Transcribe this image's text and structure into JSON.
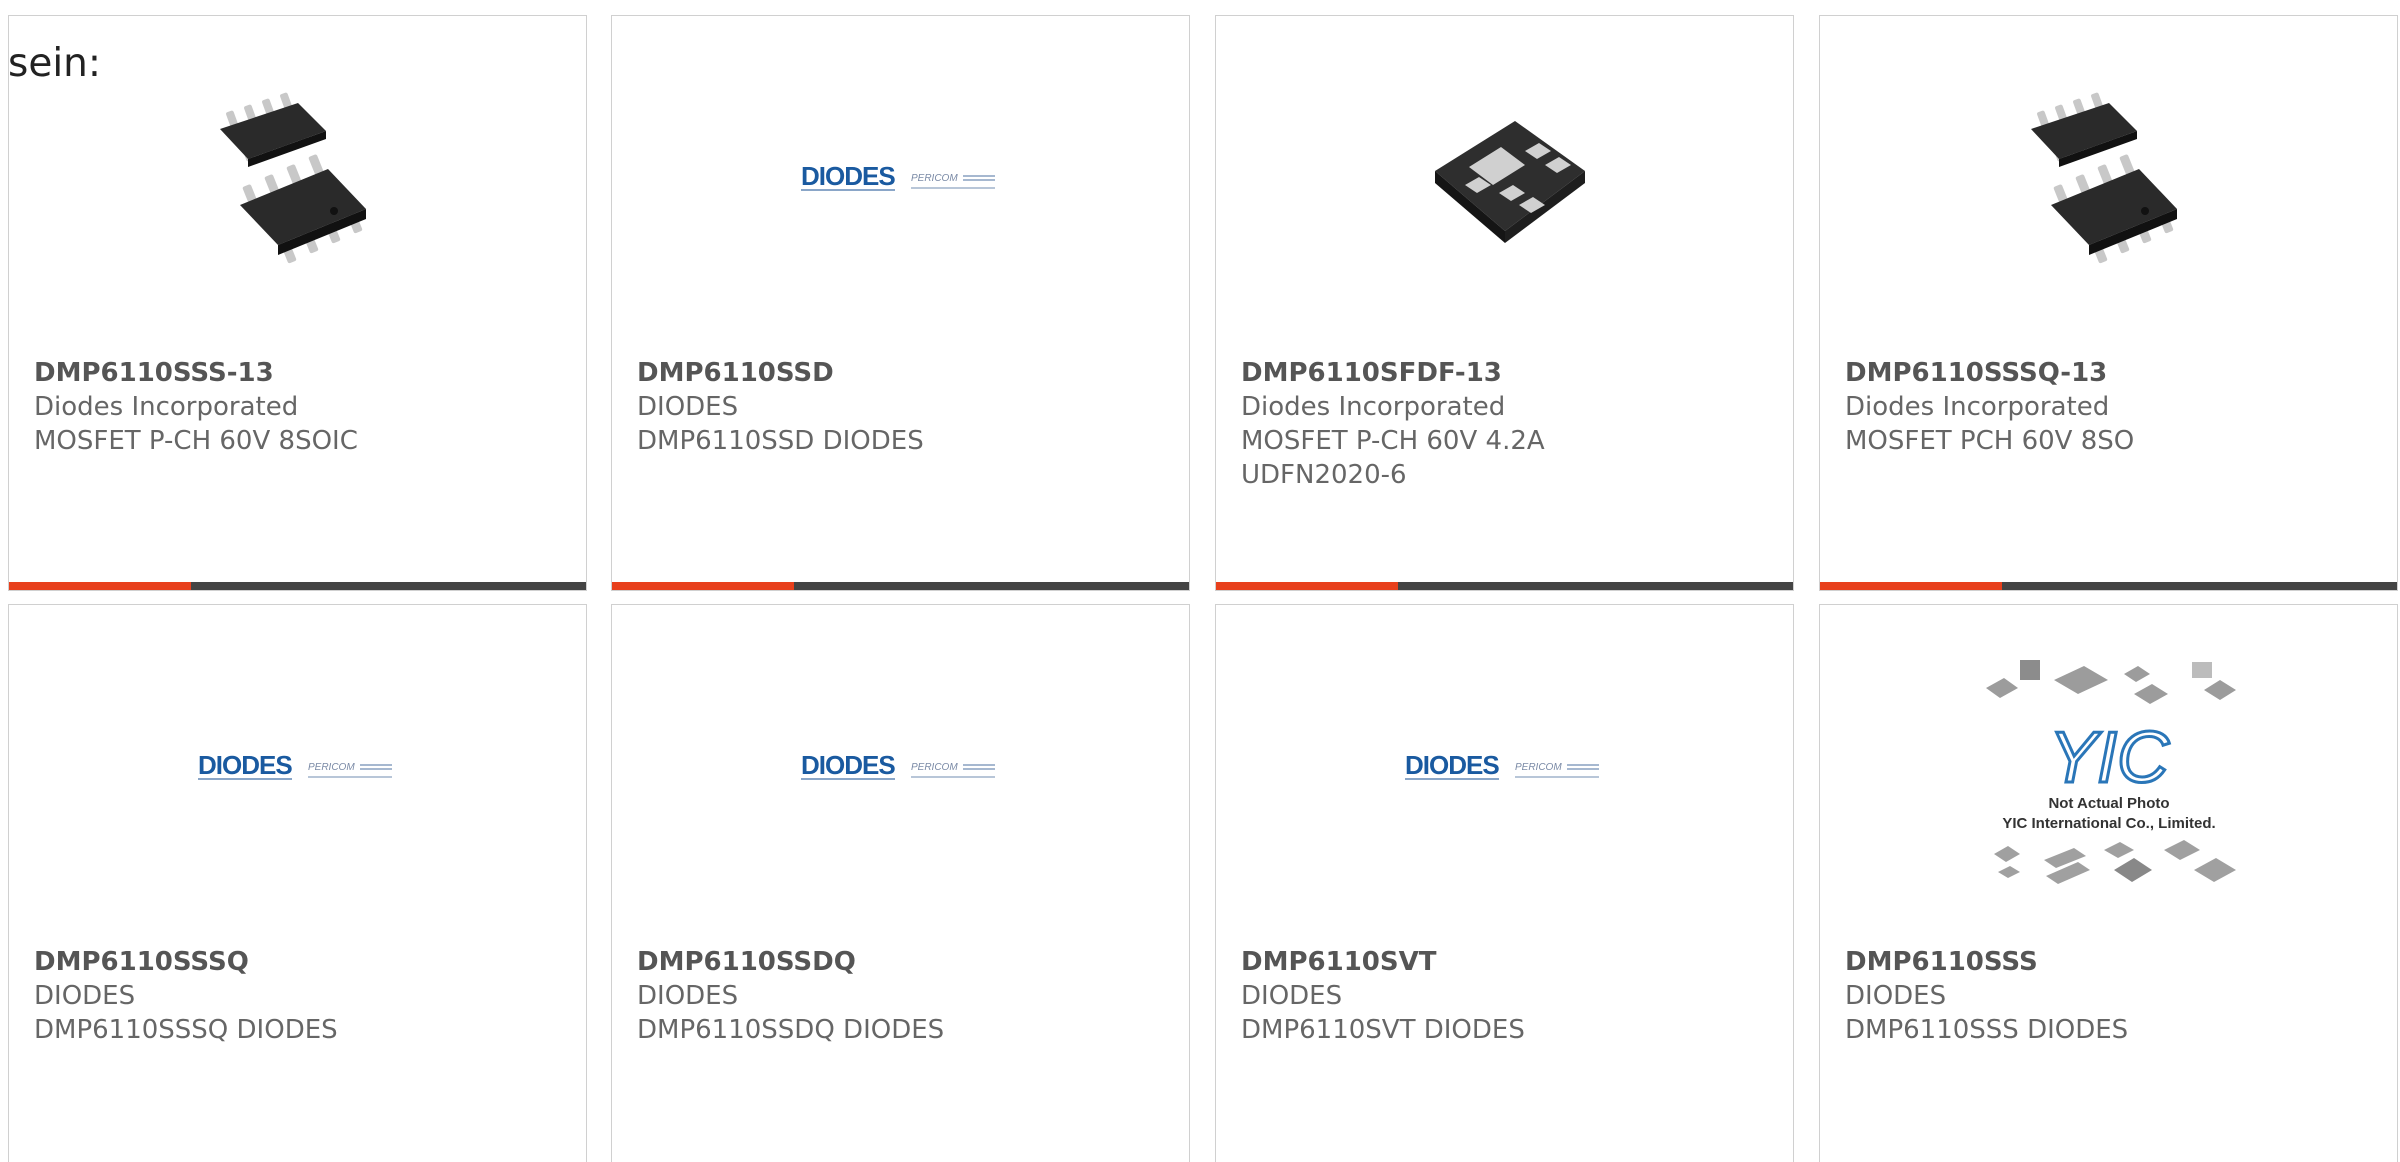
{
  "intro_text": "sein:",
  "colors": {
    "accent": "#e8401c",
    "bar": "#444444",
    "diodes_blue": "#1a5aa0",
    "border": "#d0d0d0"
  },
  "logo": {
    "brand": "DIODES",
    "partner": "PERICOM"
  },
  "placeholder": {
    "brand": "YIC",
    "line1": "Not Actual Photo",
    "line2": "YIC International Co., Limited."
  },
  "cards": [
    {
      "part": "DMP6110SSS-13",
      "mfr": "Diodes Incorporated",
      "desc": "MOSFET P-CH 60V 8SOIC",
      "image": "soic8-chip-icon"
    },
    {
      "part": "DMP6110SSD",
      "mfr": "DIODES",
      "desc": "DMP6110SSD DIODES",
      "image": "diodes-logo"
    },
    {
      "part": "DMP6110SFDF-13",
      "mfr": "Diodes Incorporated",
      "desc": "MOSFET P-CH 60V 4.2A UDFN2020-6",
      "image": "udfn-chip-icon"
    },
    {
      "part": "DMP6110SSSQ-13",
      "mfr": "Diodes Incorporated",
      "desc": "MOSFET PCH 60V 8SO",
      "image": "soic8-chip-icon"
    },
    {
      "part": "DMP6110SSSQ",
      "mfr": "DIODES",
      "desc": "DMP6110SSSQ DIODES",
      "image": "diodes-logo"
    },
    {
      "part": "DMP6110SSDQ",
      "mfr": "DIODES",
      "desc": "DMP6110SSDQ DIODES",
      "image": "diodes-logo"
    },
    {
      "part": "DMP6110SVT",
      "mfr": "DIODES",
      "desc": "DMP6110SVT DIODES",
      "image": "diodes-logo"
    },
    {
      "part": "DMP6110SSS",
      "mfr": "DIODES",
      "desc": "DMP6110SSS DIODES",
      "image": "not-actual-photo"
    }
  ]
}
